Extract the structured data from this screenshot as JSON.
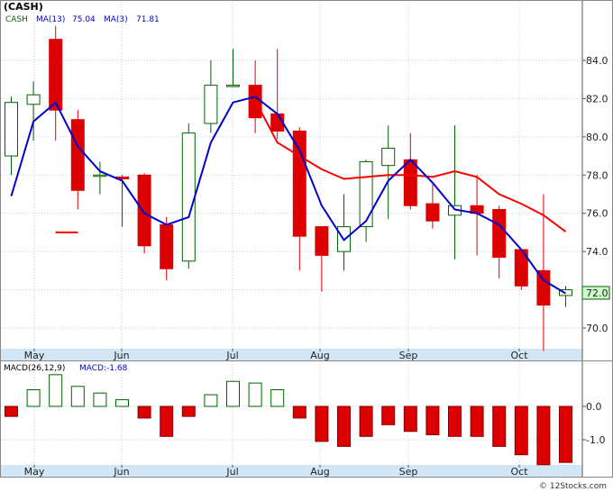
{
  "title": "(CASH)",
  "legend": {
    "symbol": "CASH",
    "ma13_label": "MA(13)",
    "ma13_value": "75.04",
    "ma3_label": "MA(3)",
    "ma3_value": "71.81"
  },
  "macd_legend": {
    "label": "MACD(26,12,9)",
    "value_label": "MACD:-1.68"
  },
  "last_price_label": "72.0",
  "watermark": "© 12Stocks.com",
  "colors": {
    "up": "#006400",
    "down": "#dd0000",
    "ma13": "#ff0000",
    "ma3": "#0000cc",
    "grid": "#b4d2e6",
    "axis_bg": "#d3e6f5",
    "price_tag_bg": "#ccffcc"
  },
  "chart_data": [
    {
      "type": "candlestick",
      "title": "(CASH)",
      "months": [
        "May",
        "Jun",
        "Jul",
        "Aug",
        "Sep",
        "Oct"
      ],
      "y_ticks": [
        70.0,
        72.0,
        74.0,
        76.0,
        78.0,
        80.0,
        82.0,
        84.0
      ],
      "ylim": [
        68.9,
        86.4
      ],
      "candles": [
        {
          "o": 79.0,
          "h": 82.1,
          "l": 78.0,
          "c": 81.8
        },
        {
          "o": 81.7,
          "h": 82.9,
          "l": 79.8,
          "c": 82.2
        },
        {
          "o": 85.1,
          "h": 85.8,
          "l": 79.8,
          "c": 81.4
        },
        {
          "o": 80.9,
          "h": 81.4,
          "l": 76.2,
          "c": 77.2
        },
        {
          "o": 78.0,
          "h": 78.7,
          "l": 77.0,
          "c": 78.0
        },
        {
          "o": 77.9,
          "h": 78.0,
          "l": 75.3,
          "c": 77.8
        },
        {
          "o": 78.0,
          "h": 78.1,
          "l": 73.9,
          "c": 74.3
        },
        {
          "o": 75.4,
          "h": 75.8,
          "l": 72.5,
          "c": 73.1
        },
        {
          "o": 73.5,
          "h": 80.7,
          "l": 73.1,
          "c": 80.2
        },
        {
          "o": 80.7,
          "h": 84.0,
          "l": 80.2,
          "c": 82.7
        },
        {
          "o": 82.7,
          "h": 84.6,
          "l": 82.6,
          "c": 82.7
        },
        {
          "o": 82.7,
          "h": 84.0,
          "l": 80.2,
          "c": 81.0
        },
        {
          "o": 81.2,
          "h": 84.6,
          "l": 79.9,
          "c": 80.3
        },
        {
          "o": 80.3,
          "h": 80.5,
          "l": 73.0,
          "c": 74.8
        },
        {
          "o": 75.3,
          "h": 75.3,
          "l": 71.9,
          "c": 73.8
        },
        {
          "o": 74.0,
          "h": 77.0,
          "l": 73.0,
          "c": 75.3
        },
        {
          "o": 75.3,
          "h": 78.8,
          "l": 74.5,
          "c": 78.7
        },
        {
          "o": 78.5,
          "h": 80.6,
          "l": 75.7,
          "c": 79.4
        },
        {
          "o": 78.8,
          "h": 80.2,
          "l": 76.2,
          "c": 76.4
        },
        {
          "o": 76.5,
          "h": 77.5,
          "l": 75.2,
          "c": 75.6
        },
        {
          "o": 75.9,
          "h": 80.6,
          "l": 73.6,
          "c": 76.4
        },
        {
          "o": 76.4,
          "h": 78.0,
          "l": 73.8,
          "c": 76.0
        },
        {
          "o": 76.2,
          "h": 76.4,
          "l": 72.6,
          "c": 73.7
        },
        {
          "o": 74.1,
          "h": 74.1,
          "l": 72.0,
          "c": 72.2
        },
        {
          "o": 73.0,
          "h": 77.0,
          "l": 68.8,
          "c": 71.2
        },
        {
          "o": 71.7,
          "h": 72.2,
          "l": 71.1,
          "c": 72.0
        }
      ],
      "series": [
        {
          "name": "MA(13)",
          "values": [
            null,
            null,
            75.0,
            75.0,
            null,
            null,
            null,
            null,
            null,
            82.1,
            null,
            81.9,
            79.7,
            79.0,
            78.3,
            77.8,
            77.9,
            78.0,
            78.0,
            77.9,
            78.2,
            77.9,
            77.0,
            76.5,
            75.9,
            75.04
          ]
        },
        {
          "name": "MA(3)",
          "values": [
            76.9,
            80.8,
            81.8,
            79.5,
            78.2,
            77.7,
            76.0,
            75.4,
            75.8,
            79.7,
            81.8,
            82.1,
            81.2,
            79.3,
            76.4,
            74.6,
            75.6,
            77.7,
            78.8,
            77.6,
            76.2,
            76.0,
            75.4,
            74.1,
            72.5,
            71.81
          ]
        }
      ]
    },
    {
      "type": "bar",
      "title": "MACD(26,12,9)",
      "months": [
        "May",
        "Jun",
        "Jul",
        "Aug",
        "Sep",
        "Oct"
      ],
      "y_ticks": [
        0.0,
        -1.0
      ],
      "ylim": [
        -1.75,
        1.0
      ],
      "values": [
        -0.3,
        0.5,
        0.95,
        0.6,
        0.4,
        0.2,
        -0.35,
        -0.9,
        -0.3,
        0.35,
        0.75,
        0.7,
        0.5,
        -0.35,
        -1.05,
        -1.2,
        -0.9,
        -0.55,
        -0.75,
        -0.85,
        -0.9,
        -0.9,
        -1.2,
        -1.45,
        -1.75,
        -1.68
      ]
    }
  ]
}
